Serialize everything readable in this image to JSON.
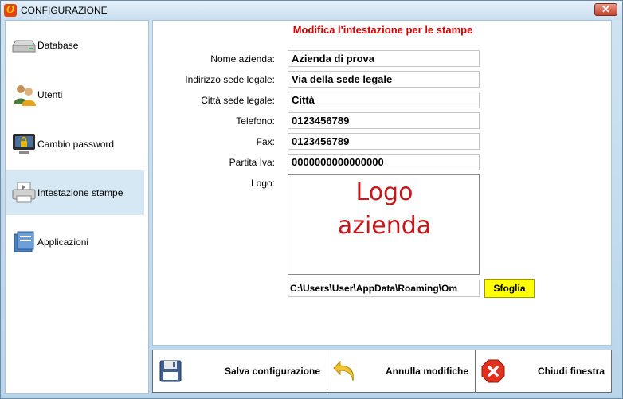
{
  "window": {
    "title": "CONFIGURAZIONE",
    "close_label": "✕"
  },
  "sidebar": {
    "items": [
      {
        "label": "Database"
      },
      {
        "label": "Utenti"
      },
      {
        "label": "Cambio password"
      },
      {
        "label": "Intestazione stampe",
        "selected": true
      },
      {
        "label": "Applicazioni"
      }
    ]
  },
  "form": {
    "heading": "Modifica l'intestazione per le stampe",
    "fields": [
      {
        "label": "Nome azienda:",
        "value": "Azienda di prova"
      },
      {
        "label": "Indirizzo sede legale:",
        "value": "Via della sede legale"
      },
      {
        "label": "Città sede legale:",
        "value": "Città"
      },
      {
        "label": "Telefono:",
        "value": "0123456789"
      },
      {
        "label": "Fax:",
        "value": "0123456789"
      },
      {
        "label": "Partita Iva:",
        "value": "0000000000000000"
      }
    ],
    "logo_label": "Logo:",
    "logo_lines": [
      "Logo",
      "azienda"
    ],
    "logo_path": "C:\\Users\\User\\AppData\\Roaming\\Om",
    "browse_label": "Sfoglia"
  },
  "footer": {
    "save_label": "Salva configurazione",
    "undo_label": "Annulla modifiche",
    "close_label": "Chiudi finestra"
  },
  "colors": {
    "heading": "#d40000",
    "browse_button": "#ffff00",
    "selected_item": "#d6e8f4",
    "logo_text": "#c8171b"
  }
}
